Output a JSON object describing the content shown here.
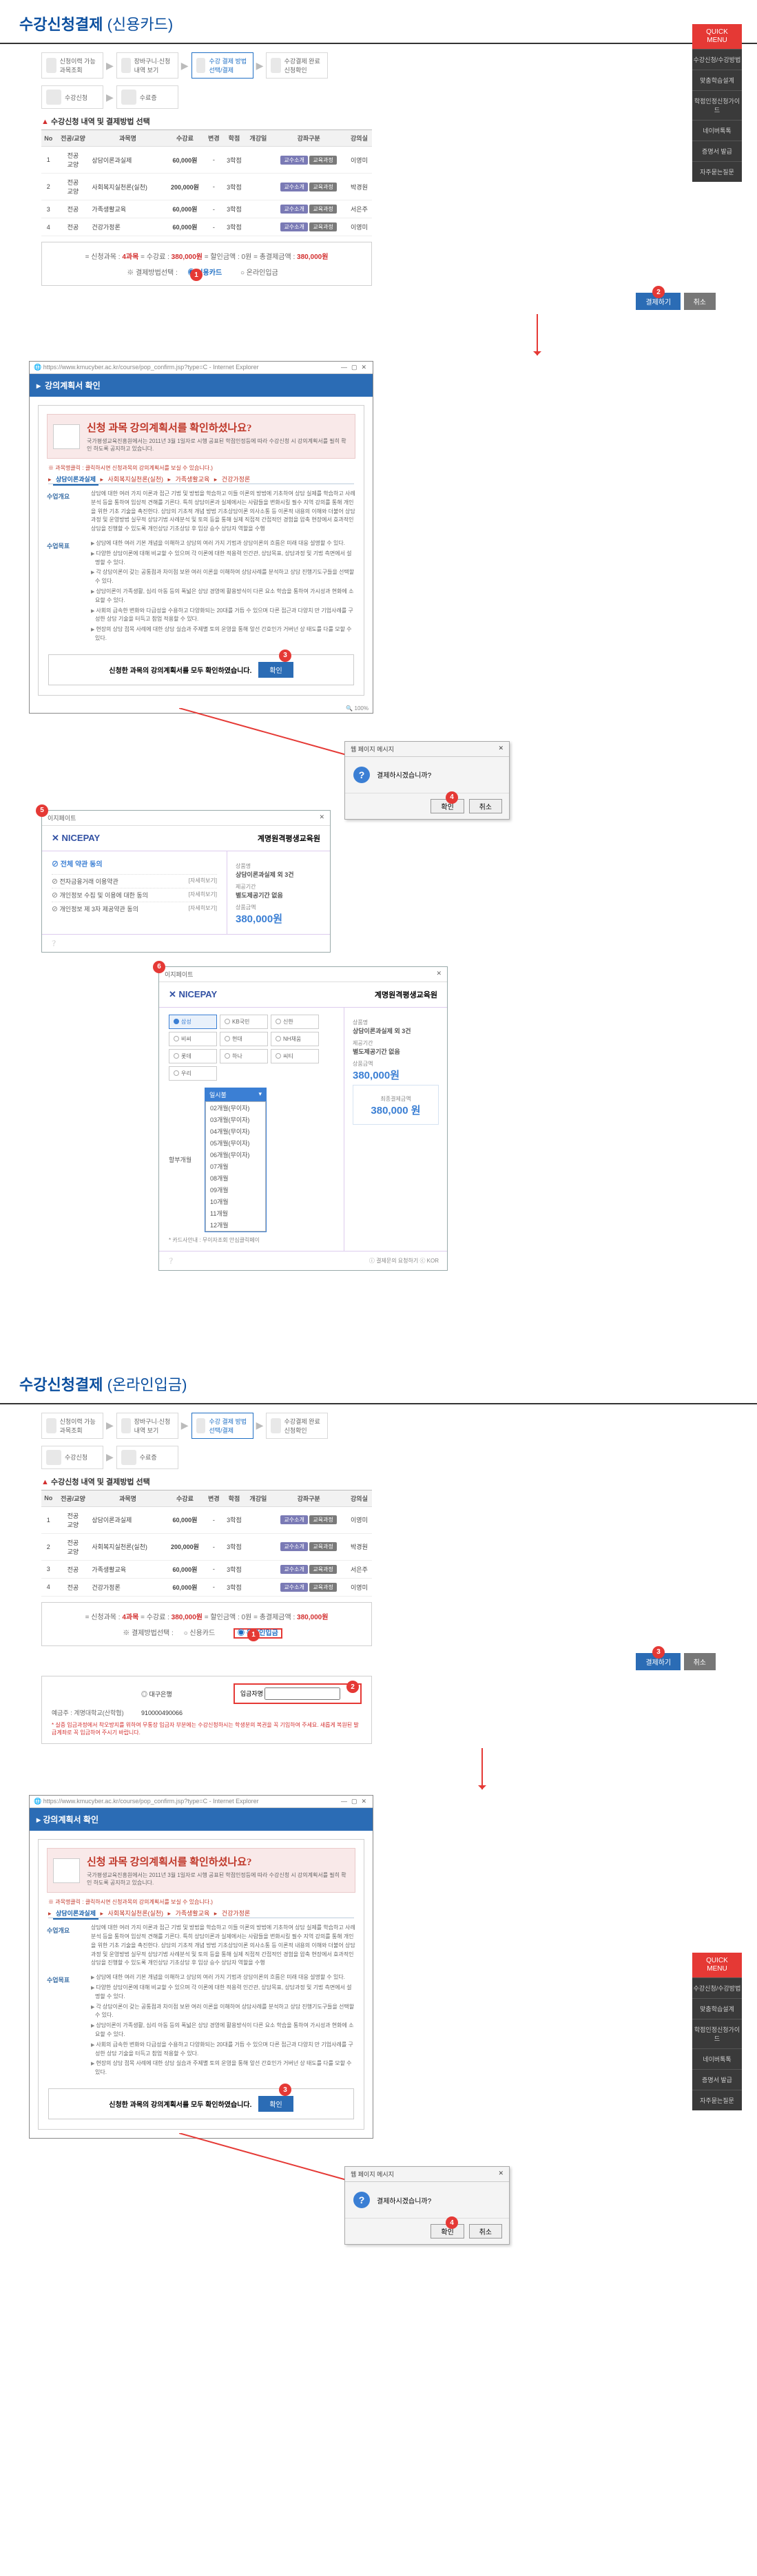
{
  "quickMenu": {
    "head": "QUICK\nMENU",
    "items": [
      "수강신청/수강방법",
      "맞춤학습설계",
      "학점인정신청가이드",
      "네이버톡톡",
      "증명서 발급",
      "자주묻는질문"
    ]
  },
  "section1": {
    "title": "수강신청결제",
    "sub": "(신용카드)",
    "steps": [
      "신청이력 가능과목조회",
      "장바구니·신청 내역 보기",
      "수강 결제 방법선택/결제",
      "수강결제 완료 신청확인",
      "수강신청",
      "수료증"
    ],
    "subHeader": "수강신청 내역 및 결제방법 선택",
    "th": [
      "No",
      "전공/교양",
      "과목명",
      "수강료",
      "변경",
      "학점",
      "개강일",
      "강좌구분",
      "강의실"
    ],
    "rows": [
      {
        "no": "1",
        "cat": "전공\n교양",
        "name": "상담이론과실제",
        "fee": "60,000원",
        "chg": "-",
        "cr": "3학점",
        "btns": [
          "교수소개",
          "교육과정"
        ],
        "room": "이영미"
      },
      {
        "no": "2",
        "cat": "전공\n교양",
        "name": "사회복지실천론(실천)",
        "fee": "200,000원",
        "chg": "-",
        "cr": "3학점",
        "btns": [
          "교수소개",
          "교육과정"
        ],
        "room": "박경원"
      },
      {
        "no": "3",
        "cat": "전공",
        "name": "가족생활교육",
        "fee": "60,000원",
        "chg": "-",
        "cr": "3학점",
        "btns": [
          "교수소개",
          "교육과정"
        ],
        "room": "서은주"
      },
      {
        "no": "4",
        "cat": "전공",
        "name": "건강가정론",
        "fee": "60,000원",
        "chg": "-",
        "cr": "3학점",
        "btns": [
          "교수소개",
          "교육과정"
        ],
        "room": "이영미"
      }
    ],
    "summary": {
      "pre": "= 신청과목 :",
      "cnt": "4과목",
      "mid": "= 수강료 :",
      "fee": "380,000원",
      "mid2": "= 할인금액 : 0원 = 총결제금액 :",
      "tot": "380,000원"
    },
    "payLabel": "※ 결제방법선택 :",
    "pay1": "신용카드",
    "pay2": "온라인입금",
    "btnPay": "결제하기",
    "btnCancel": "취소"
  },
  "plan": {
    "url": "https://www.kmucyber.ac.kr/course/pop_confirm.jsp?type=C - Internet Explorer",
    "header": "강의계획서 확인",
    "title": "신청 과목 강의계획서를 확인하셨나요?",
    "small": "국가평생교육진흥원에서는 2011년 3월 1일자로 시행 공표된 학점인정등에 따라 수강신청 시 강의계획서를 필히 확인 하도록 공지하고 있습니다.",
    "redBullet": "※ 과목명클릭 : 클릭하시면 신청과목의 강의계획서를 보실 수 있습니다.)",
    "tabs": [
      "상담이론과실제",
      "사회복지실천론(실천)",
      "가족생활교육",
      "건강가정론"
    ],
    "rowLbl1": "수업개요",
    "rowTxt1": "상담에 대한 여러 가지 이론과 접근 기법 및 방법을 학습하고 이들 이론의 방법에 기초하여 상담 실제를 학습하고 사례 분석 등을 통하여 임상적 견해를 기른다. 특히 상담이론과 실제에서는 사람들을 변화시킬 필수 지역 강의를 통해 개인을 위한 기초 기술을 촉진한다. 상담의 기초적 개념 방법 기초상담이론 의사소통 등 이론적 내용의 이해와 더불어 상담 과정 및 운영방법 실무적 상담기법 사례분석 및 토의 등을 통해 실제 직접적 간접적인 경험을 압축 현장에서 효과적인 상담을 진행할 수 있도록 개인상담 기초상담 후 임상 승수 상담자 역할을 수행",
    "rowLbl2": "수업목표",
    "rowTxt2": [
      "상담에 대한 여러 기본 개념을 이해하고 상담의 여러 가지 기법과 상담이론의 흐름은 미래 대응 설명할 수 있다.",
      "다양한 상담이론에 대해 비교할 수 있으며 각 이론에 대한 적용력 인간관, 상담목표, 상담과정 및 기법 측면에서 설명할 수 있다.",
      "각 상담이론이 갖는 공통점과 차이점 보완 여러 이론을 이해하여 상담사례를 분석하고 상담 진행기도구들을 선택할 수 있다.",
      "상담이론이 가족생활, 심리 아동 등의 폭넓은 상담 경영에 활용방식이 다른 요소 학습을 통하여 가시성과 현화에 소요할 수 있다.",
      "사회의 급속한 변화와 다급성을 수용하고 다양화되는 20대를 거듭 수 있으며 다른 접근과 다양치 만 기업사례를 구성한 상담 기술을 터득고 참업 적용할 수 있다.",
      "현장의 상담 접목 사례에 대한 상담 실습과 주제별 토의 운영을 통해 앞선 간호인가 거버넌 상 태도를 다룰 모할 수 있다."
    ],
    "confirmText": "신청한 과목의 강의계획서를 모두 확인하였습니다.",
    "btnConfirm": "확인"
  },
  "msg": {
    "title": "웹 페이지 메시지",
    "text": "결제하시겠습니까?",
    "ok": "확인",
    "cancel": "취소"
  },
  "nice": {
    "winTitle": "이지페이트",
    "brand": "NICEPAY",
    "merch": "계명원격평생교육원",
    "agreeHead": "전체 약관 동의",
    "agrees": [
      [
        "전자금융거래 이용약관",
        "[자세히보기]"
      ],
      [
        "개인정보 수집 및 이용에 대한 동의",
        "[자세히보기]"
      ],
      [
        "개인정보 제 3자 제공약관 동의",
        "[자세히보기]"
      ]
    ],
    "rk1": "상품명",
    "rv1": "상담이론과실제 외 3건",
    "rk2": "제공기간",
    "rv2": "별도제공기간 없음",
    "rk3": "상품금액",
    "rv3": "380,000원"
  },
  "nice2": {
    "cards": [
      "삼성",
      "KB국민",
      "신한",
      "비씨",
      "현대",
      "NH채움",
      "롯데",
      "하나",
      "씨티",
      "우리"
    ],
    "payLbl": "할부개월",
    "ddSel": "일시불",
    "ddOpts": [
      "02개월(무이자)",
      "03개월(무이자)",
      "04개월(무이자)",
      "05개월(무이자)",
      "06개월(무이자)",
      "07개월",
      "08개월",
      "09개월",
      "10개월",
      "11개월",
      "12개월"
    ],
    "note1": "* 카드사안내 :",
    "note2": " 무이자조회",
    "note3": " 안심클릭페이",
    "amtLbl": "최종결제금액",
    "amt": "380,000 원",
    "foot": "ⓘ 결제문의 요청하기  ⓒ KOR"
  },
  "section2": {
    "title": "수강신청결제",
    "sub": "(온라인입금)",
    "btnPay": "결제하기",
    "btnCancel": "취소",
    "depositor": "입금자명",
    "bank": {
      "rad": "◎ 대구은행",
      "accLbl": "예금주 : 계명대학교(산학협)",
      "acc": "910000490066",
      "note": "* 실증 입금과정에서 착오방지를 위하여 무통장 입금자 부분에는 수강신청하시는 학생분의 복권을 꼭 기입하여 주세요.\n새롭게 복원된 발급계좌로 꼭 입금하여 주시기 바랍니다."
    }
  }
}
